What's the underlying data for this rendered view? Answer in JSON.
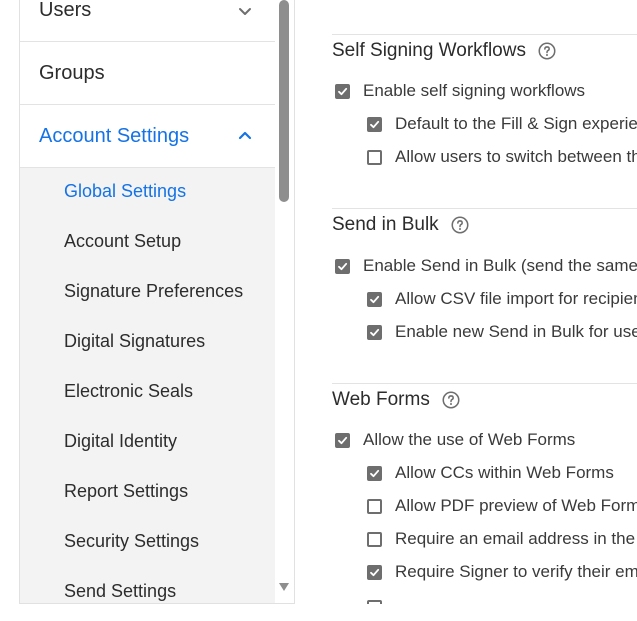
{
  "sidebar": {
    "items": [
      {
        "label": "Users"
      },
      {
        "label": "Groups"
      },
      {
        "label": "Account Settings"
      }
    ],
    "submenu": [
      {
        "label": "Global Settings"
      },
      {
        "label": "Account Setup"
      },
      {
        "label": "Signature Preferences"
      },
      {
        "label": "Digital Signatures"
      },
      {
        "label": "Electronic Seals"
      },
      {
        "label": "Digital Identity"
      },
      {
        "label": "Report Settings"
      },
      {
        "label": "Security Settings"
      },
      {
        "label": "Send Settings"
      }
    ]
  },
  "sections": [
    {
      "title": "Self Signing Workflows",
      "options": [
        {
          "label": "Enable self signing workflows",
          "checked": true
        },
        {
          "label": "Default to the Fill & Sign experien",
          "checked": true
        },
        {
          "label": "Allow users to switch between th",
          "checked": false
        }
      ]
    },
    {
      "title": "Send in Bulk",
      "options": [
        {
          "label": "Enable Send in Bulk (send the same a",
          "checked": true
        },
        {
          "label": "Allow CSV file import for recipien",
          "checked": true
        },
        {
          "label": "Enable new Send in Bulk for users",
          "checked": true
        }
      ]
    },
    {
      "title": "Web Forms",
      "options": [
        {
          "label": "Allow the use of Web Forms",
          "checked": true
        },
        {
          "label": "Allow CCs within Web Forms",
          "checked": true
        },
        {
          "label": "Allow PDF preview of Web Forms",
          "checked": false
        },
        {
          "label": "Require an email address in the si",
          "checked": false
        },
        {
          "label": "Require Signer to verify their ema",
          "checked": true
        }
      ]
    }
  ],
  "colors": {
    "accent": "#1473e6",
    "checkbox": "#6e6e6e",
    "submenu_bg": "#f3f3f3"
  },
  "icons": [
    "chevron-down-icon",
    "chevron-up-icon",
    "help-icon",
    "scroll-down-arrow-icon"
  ]
}
